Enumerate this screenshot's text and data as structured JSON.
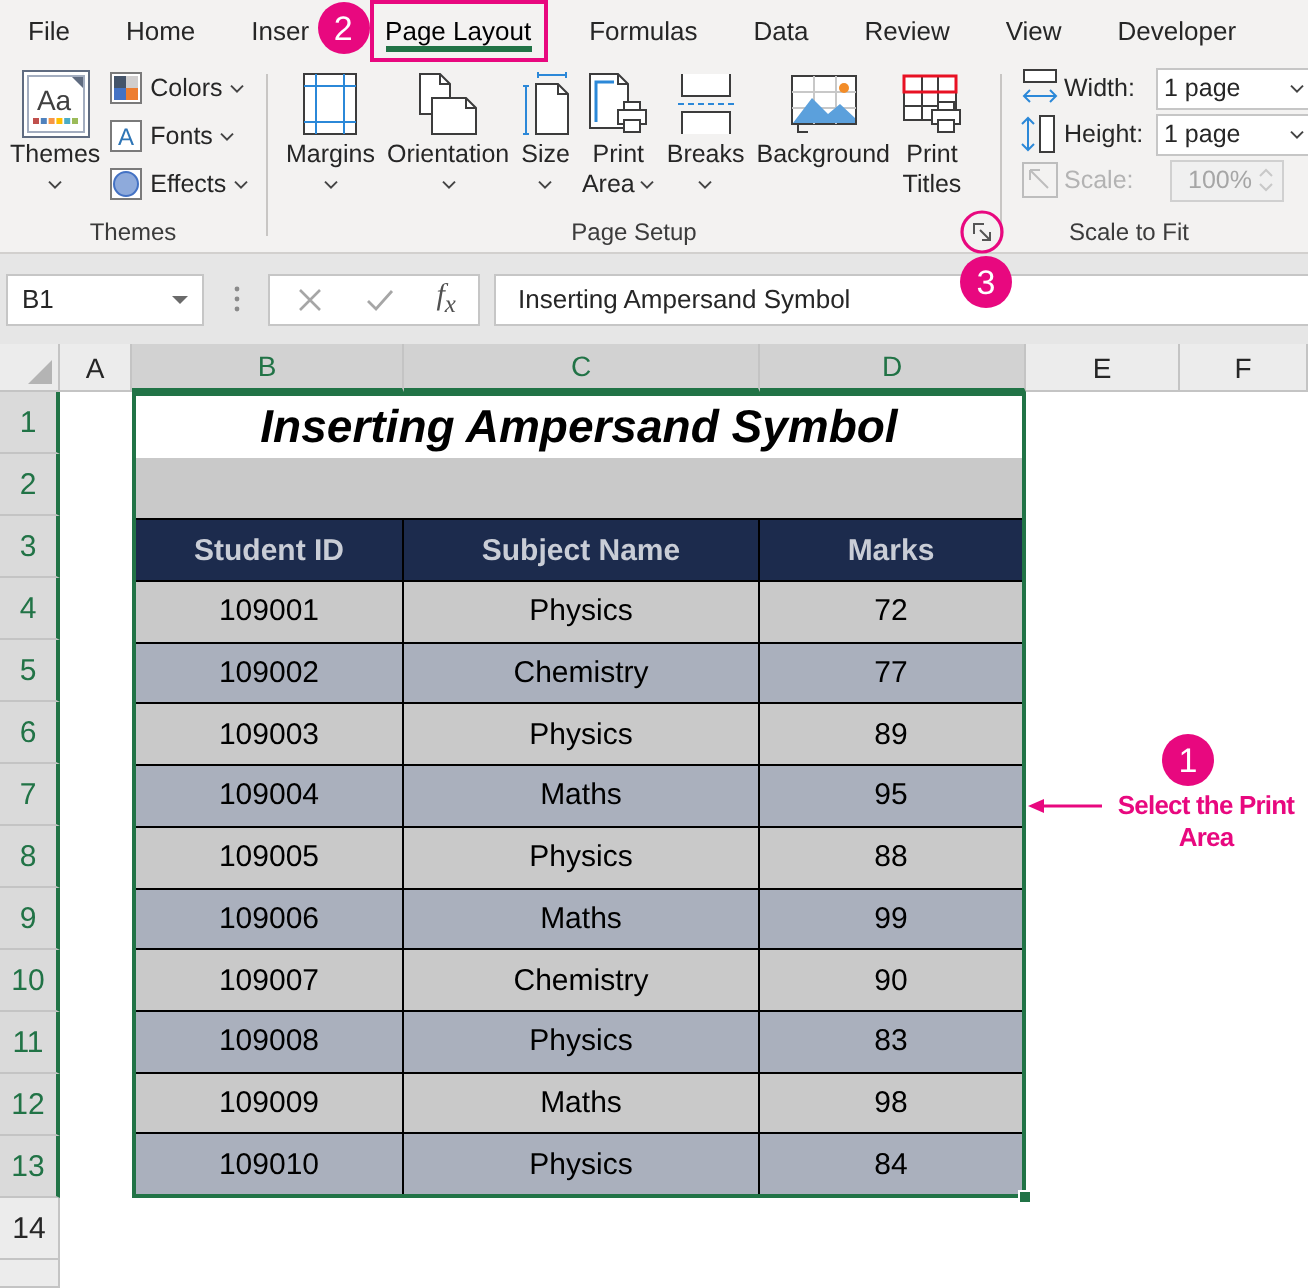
{
  "ribbon_tabs": [
    {
      "label": "File",
      "selected": false,
      "highlighted": false
    },
    {
      "label": "Home",
      "selected": false,
      "highlighted": false
    },
    {
      "label": "Inser",
      "selected": false,
      "highlighted": false
    },
    {
      "label": "Page Layout",
      "selected": true,
      "highlighted": true
    },
    {
      "label": "Formulas",
      "selected": false,
      "highlighted": false
    },
    {
      "label": "Data",
      "selected": false,
      "highlighted": false
    },
    {
      "label": "Review",
      "selected": false,
      "highlighted": false
    },
    {
      "label": "View",
      "selected": false,
      "highlighted": false
    },
    {
      "label": "Developer",
      "selected": false,
      "highlighted": false
    }
  ],
  "themes_group": {
    "label": "Themes",
    "main_button": {
      "lines": [
        "Themes"
      ],
      "glyph": "Aa",
      "has_menu": true
    },
    "options": [
      {
        "kind": "colors",
        "label": "Colors",
        "has_menu": true
      },
      {
        "kind": "fonts",
        "label": "Fonts",
        "glyph": "A",
        "has_menu": true
      },
      {
        "kind": "effects",
        "label": "Effects",
        "has_menu": true
      }
    ]
  },
  "page_setup_group": {
    "label": "Page Setup",
    "buttons": [
      {
        "kind": "margins",
        "lines": [
          "Margins"
        ],
        "has_menu": true
      },
      {
        "kind": "orientation",
        "lines": [
          "Orientation"
        ],
        "has_menu": true
      },
      {
        "kind": "size",
        "lines": [
          "Size"
        ],
        "has_menu": true
      },
      {
        "kind": "print_area",
        "lines": [
          "Print",
          "Area"
        ],
        "has_menu": true
      },
      {
        "kind": "breaks",
        "lines": [
          "Breaks"
        ],
        "has_menu": true
      },
      {
        "kind": "background",
        "lines": [
          "Background"
        ],
        "has_menu": false
      },
      {
        "kind": "print_titles",
        "lines": [
          "Print",
          "Titles"
        ],
        "has_menu": false
      }
    ]
  },
  "scale_to_fit_group": {
    "label": "Scale to Fit",
    "fields": [
      {
        "kind": "width",
        "label": "Width:",
        "value": "1 page",
        "disabled": false
      },
      {
        "kind": "height",
        "label": "Height:",
        "value": "1 page",
        "disabled": false
      },
      {
        "kind": "scale",
        "label": "Scale:",
        "value": "100%",
        "disabled": true
      }
    ]
  },
  "formula_bar": {
    "name_box": "B1",
    "function_glyph": "f$_{x}$",
    "formula": "Inserting Ampersand Symbol"
  },
  "column_headers": [
    {
      "label": "A",
      "selected": false
    },
    {
      "label": "B",
      "selected": true
    },
    {
      "label": "C",
      "selected": true
    },
    {
      "label": "D",
      "selected": true
    },
    {
      "label": "E",
      "selected": false
    },
    {
      "label": "F",
      "selected": false
    }
  ],
  "row_headers": [
    {
      "label": "1",
      "selected": true
    },
    {
      "label": "2",
      "selected": true
    },
    {
      "label": "3",
      "selected": true
    },
    {
      "label": "4",
      "selected": true
    },
    {
      "label": "5",
      "selected": true
    },
    {
      "label": "6",
      "selected": true
    },
    {
      "label": "7",
      "selected": true
    },
    {
      "label": "8",
      "selected": true
    },
    {
      "label": "9",
      "selected": true
    },
    {
      "label": "10",
      "selected": true
    },
    {
      "label": "11",
      "selected": true
    },
    {
      "label": "12",
      "selected": true
    },
    {
      "label": "13",
      "selected": true
    },
    {
      "label": "14",
      "selected": false
    }
  ],
  "sheet_table": {
    "selected": true,
    "title": "Inserting Ampersand Symbol",
    "columns": [
      "Student ID",
      "Subject Name",
      "Marks"
    ],
    "rows": [
      [
        "109001",
        "Physics",
        "72"
      ],
      [
        "109002",
        "Chemistry",
        "77"
      ],
      [
        "109003",
        "Physics",
        "89"
      ],
      [
        "109004",
        "Maths",
        "95"
      ],
      [
        "109005",
        "Physics",
        "88"
      ],
      [
        "109006",
        "Maths",
        "99"
      ],
      [
        "109007",
        "Chemistry",
        "90"
      ],
      [
        "109008",
        "Physics",
        "83"
      ],
      [
        "109009",
        "Maths",
        "98"
      ],
      [
        "109010",
        "Physics",
        "84"
      ]
    ]
  },
  "callouts": [
    {
      "kind": "tab",
      "number": "2"
    },
    {
      "kind": "launcher",
      "number": "3"
    },
    {
      "kind": "print_area",
      "number": "1",
      "note": "Select the Print Area"
    }
  ]
}
